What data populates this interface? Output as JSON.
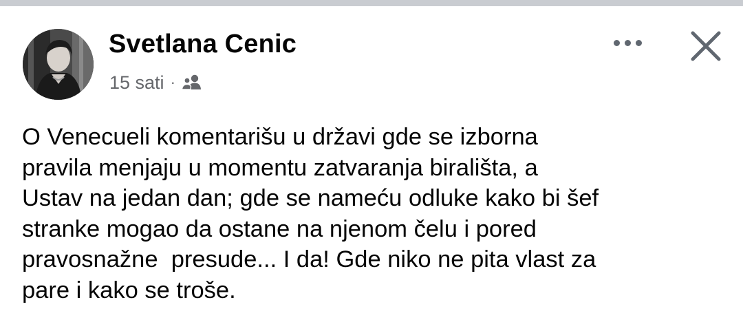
{
  "post": {
    "author_name": "Svetlana Cenic",
    "timestamp": "15 sati",
    "separator": "·",
    "audience_icon": "friends-icon",
    "more_icon": "more-horizontal-icon",
    "close_icon": "close-icon",
    "text": "O Venecueli komentarišu u državi gde se izborna\npravila menjaju u momentu zatvaranja birališta, a\nUstav na jedan dan; gde se nameću odluke kako bi šef\nstranke mogao da ostane na njenom čelu i pored\npravosnažne  presude... I da! Gde niko ne pita vlast za\npare i kako se troše."
  },
  "colors": {
    "text_primary": "#050505",
    "text_secondary": "#65676b",
    "icon_gray": "#606770",
    "top_strip": "#c9ccd1"
  }
}
